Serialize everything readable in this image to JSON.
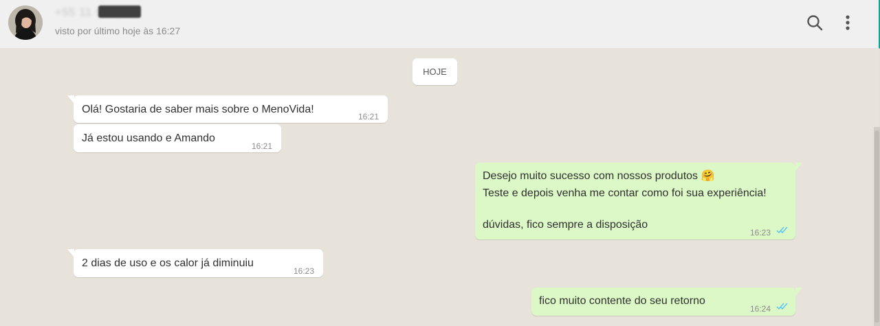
{
  "header": {
    "contact_name": "+55 11 9 4227",
    "status": "visto por último hoje às 16:27",
    "icons": [
      "search-icon",
      "menu-icon"
    ]
  },
  "chat": {
    "date_label": "HOJE",
    "messages": [
      {
        "direction": "in",
        "text": "Olá! Gostaria de saber mais sobre o MenoVida!",
        "time": "16:21"
      },
      {
        "direction": "in",
        "text": "Já estou usando e Amando",
        "time": "16:21"
      },
      {
        "direction": "out",
        "lines": [
          "Desejo muito sucesso com nossos produtos",
          "Teste e depois venha me contar como foi sua experiência!",
          "",
          "dúvidas, fico sempre a disposição"
        ],
        "emoji": "🤗",
        "time": "16:23",
        "status": "read"
      },
      {
        "direction": "in",
        "text": "2 dias de uso e os calor já diminuiu",
        "time": "16:23"
      },
      {
        "direction": "out",
        "text": "fico muito contente do seu retorno",
        "time": "16:24",
        "status": "read"
      }
    ]
  },
  "colors": {
    "header_bg": "#f0f0f0",
    "chat_bg": "#e8e3da",
    "incoming_bubble": "#ffffff",
    "outgoing_bubble": "#dcf8c6",
    "read_ticks": "#4fc3f7",
    "accent": "#1aa18d"
  }
}
